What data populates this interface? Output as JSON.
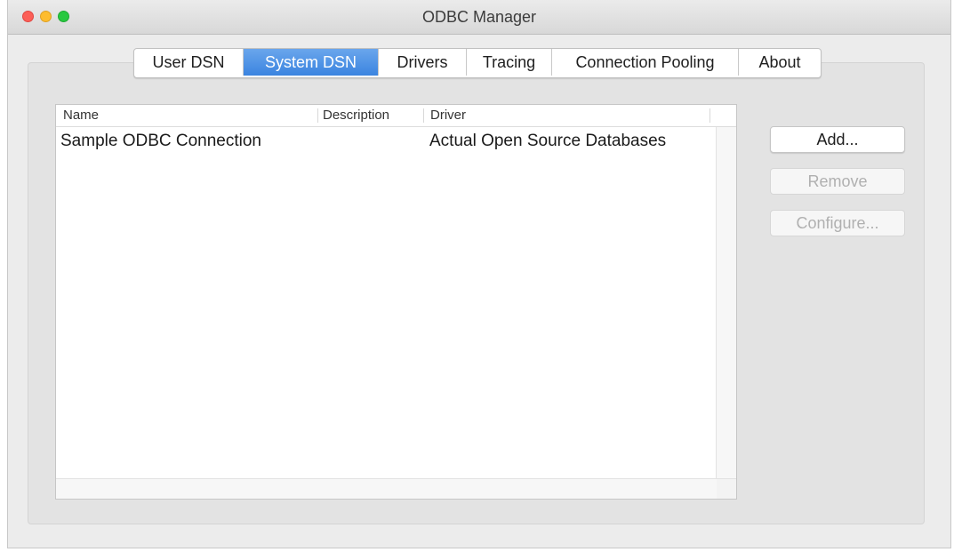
{
  "window": {
    "title": "ODBC Manager",
    "controls": [
      "close",
      "minimize",
      "zoom"
    ]
  },
  "tabs": [
    {
      "label": "User DSN",
      "active": false
    },
    {
      "label": "System DSN",
      "active": true
    },
    {
      "label": "Drivers",
      "active": false
    },
    {
      "label": "Tracing",
      "active": false
    },
    {
      "label": "Connection Pooling",
      "active": false
    },
    {
      "label": "About",
      "active": false
    }
  ],
  "table": {
    "columns": [
      "Name",
      "Description",
      "Driver"
    ],
    "rows": [
      {
        "name": "Sample ODBC Connection",
        "description": "",
        "driver": "Actual Open Source Databases"
      }
    ]
  },
  "buttons": {
    "add": "Add...",
    "remove": "Remove",
    "configure": "Configure..."
  },
  "colors": {
    "active_tab": "#3b84e0",
    "close": "#fc5f57",
    "minimize": "#fdbc2e",
    "zoom": "#28c840"
  }
}
